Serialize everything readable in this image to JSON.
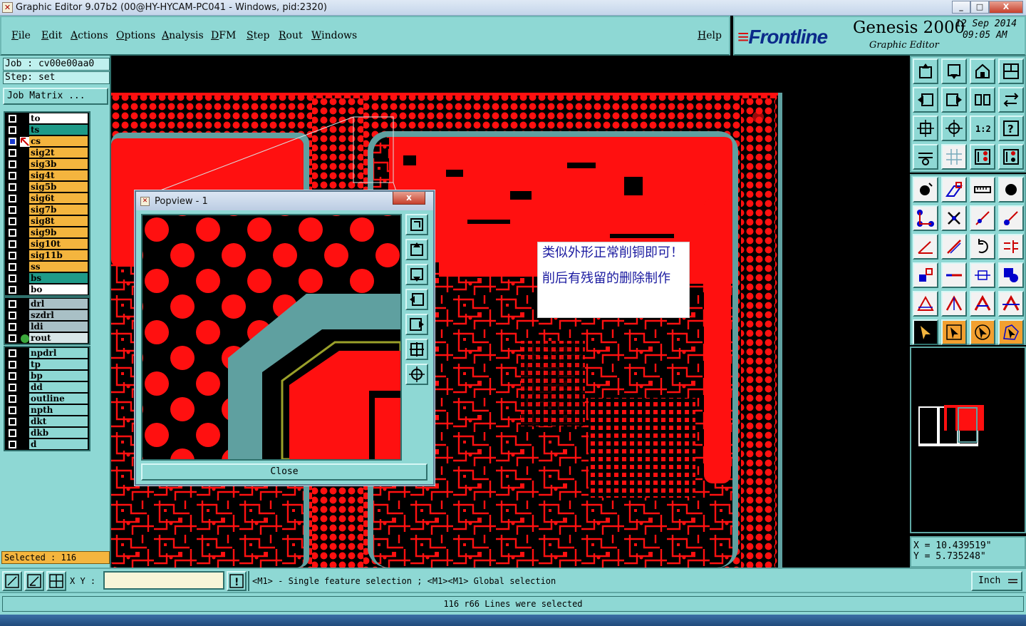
{
  "window": {
    "title": "Graphic Editor 9.07b2 (00@HY-HYCAM-PC041 - Windows, pid:2320)",
    "minimize": "_",
    "maximize": "□",
    "close": "X"
  },
  "menu": {
    "items": [
      "File",
      "Edit",
      "Actions",
      "Options",
      "Analysis",
      "DFM",
      "Step",
      "Rout",
      "Windows"
    ],
    "help": "Help"
  },
  "brand": {
    "logo": "Frontline",
    "product": "Genesis 2000",
    "subtitle": "Graphic Editor",
    "date": "12 Sep 2014",
    "time": "09:05 AM"
  },
  "job": {
    "job_label": "Job : cv00e00aa0",
    "step_label": "Step: set",
    "matrix_button": "Job Matrix ..."
  },
  "layers": {
    "group1": [
      {
        "name": "to",
        "color": "#ffffff"
      },
      {
        "name": "ts",
        "color": "#1f9a88"
      },
      {
        "name": "cs",
        "color": "#f4b53e",
        "active": true
      },
      {
        "name": "sig2t",
        "color": "#f4b53e"
      },
      {
        "name": "sig3b",
        "color": "#f4b53e"
      },
      {
        "name": "sig4t",
        "color": "#f4b53e"
      },
      {
        "name": "sig5b",
        "color": "#f4b53e"
      },
      {
        "name": "sig6t",
        "color": "#f4b53e"
      },
      {
        "name": "sig7b",
        "color": "#f4b53e"
      },
      {
        "name": "sig8t",
        "color": "#f4b53e"
      },
      {
        "name": "sig9b",
        "color": "#f4b53e"
      },
      {
        "name": "sig10t",
        "color": "#f4b53e"
      },
      {
        "name": "sig11b",
        "color": "#f4b53e"
      },
      {
        "name": "ss",
        "color": "#f4b53e"
      },
      {
        "name": "bs",
        "color": "#1f9a88"
      },
      {
        "name": "bo",
        "color": "#ffffff"
      }
    ],
    "group2": [
      {
        "name": "drl",
        "color": "#a9c0c6"
      },
      {
        "name": "szdrl",
        "color": "#a9c0c6"
      },
      {
        "name": "ldi",
        "color": "#a9c0c6"
      },
      {
        "name": "rout",
        "color": "#d8e6e8",
        "affected": true
      }
    ],
    "group3": [
      {
        "name": "npdrl",
        "color": "#8ed8d4"
      },
      {
        "name": "tp",
        "color": "#8ed8d4"
      },
      {
        "name": "bp",
        "color": "#8ed8d4"
      },
      {
        "name": "dd",
        "color": "#8ed8d4"
      },
      {
        "name": "outline",
        "color": "#8ed8d4"
      },
      {
        "name": "npth",
        "color": "#8ed8d4"
      },
      {
        "name": "dkt",
        "color": "#8ed8d4"
      },
      {
        "name": "dkb",
        "color": "#8ed8d4"
      },
      {
        "name": "d",
        "color": "#8ed8d4"
      }
    ]
  },
  "selected_status": "Selected : 116",
  "popview": {
    "title": "Popview - 1",
    "close_label": "Close",
    "close_x": "x"
  },
  "note": {
    "line1": "类似外形正常削铜即可！",
    "line2": "削后有残留的删除制作"
  },
  "coords": {
    "x": "X = 10.439519\"",
    "y": "Y = 5.735248\""
  },
  "cmdbar": {
    "xy_label": "X Y :",
    "xy_value": "",
    "prompt": "<M1> - Single feature selection ; <M1><M1> Global selection",
    "units": "Inch",
    "warn_icon": "!"
  },
  "status_message": "116 r66 Lines were selected",
  "colors": {
    "panel": "#8ed8d4",
    "copper": "#ff1010",
    "highlight": "#5fa0a0",
    "signal_layer": "#f4b53e",
    "mask_layer": "#1f9a88"
  }
}
